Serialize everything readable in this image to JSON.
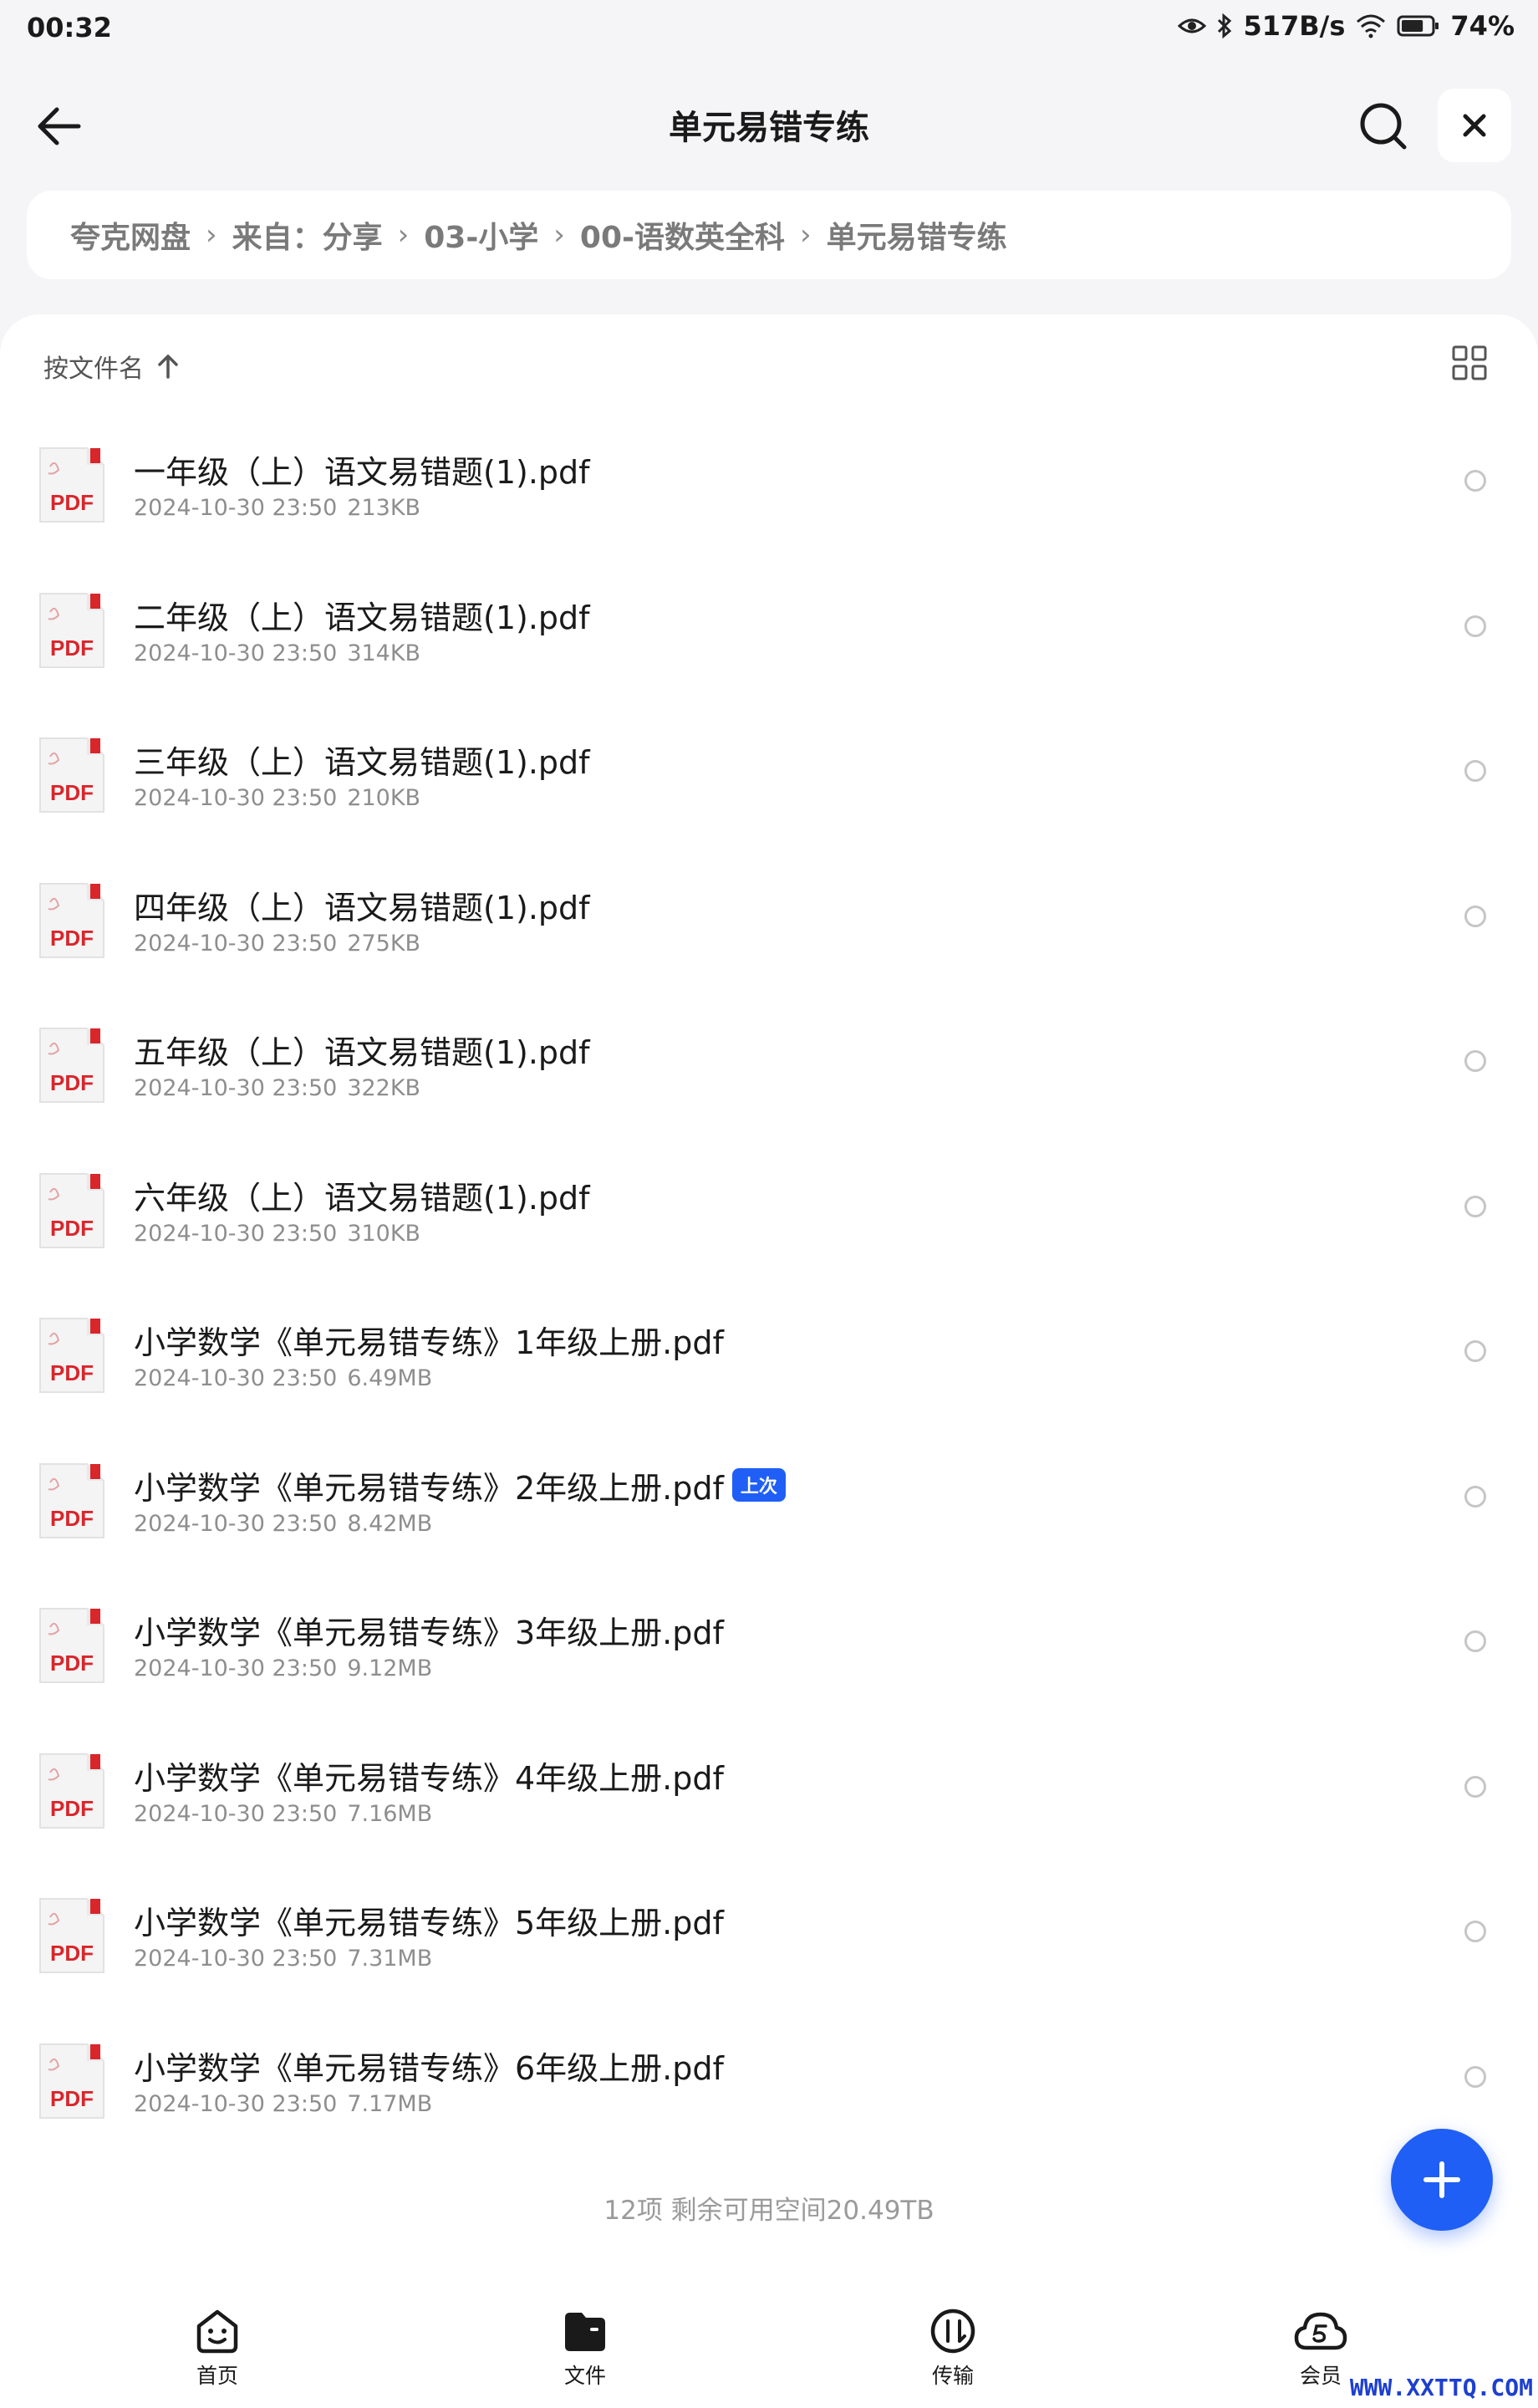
{
  "status_bar": {
    "time": "00:32",
    "net_speed": "517B/s",
    "battery": "74%",
    "battery_level": 0.74,
    "icons": [
      "eye-icon",
      "bluetooth-icon",
      "wifi-icon",
      "battery-icon"
    ]
  },
  "header": {
    "title": "单元易错专练",
    "icons": {
      "back": "back-arrow-icon",
      "search": "search-icon",
      "close": "close-icon"
    }
  },
  "breadcrumb": [
    "夸克网盘",
    "来自：分享",
    "03-小学",
    "00-语数英全科",
    "单元易错专练"
  ],
  "sort": {
    "label": "按文件名",
    "direction": "ascending"
  },
  "files": [
    {
      "name": "一年级（上）语文易错题(1).pdf",
      "date": "2024-10-30 23:50",
      "size": "213KB"
    },
    {
      "name": "二年级（上）语文易错题(1).pdf",
      "date": "2024-10-30 23:50",
      "size": "314KB"
    },
    {
      "name": "三年级（上）语文易错题(1).pdf",
      "date": "2024-10-30 23:50",
      "size": "210KB"
    },
    {
      "name": "四年级（上）语文易错题(1).pdf",
      "date": "2024-10-30 23:50",
      "size": "275KB"
    },
    {
      "name": "五年级（上）语文易错题(1).pdf",
      "date": "2024-10-30 23:50",
      "size": "322KB"
    },
    {
      "name": "六年级（上）语文易错题(1).pdf",
      "date": "2024-10-30 23:50",
      "size": "310KB"
    },
    {
      "name": "小学数学《单元易错专练》1年级上册.pdf",
      "date": "2024-10-30 23:50",
      "size": "6.49MB"
    },
    {
      "name": "小学数学《单元易错专练》2年级上册.pdf",
      "date": "2024-10-30 23:50",
      "size": "8.42MB",
      "badge": "上次"
    },
    {
      "name": "小学数学《单元易错专练》3年级上册.pdf",
      "date": "2024-10-30 23:50",
      "size": "9.12MB"
    },
    {
      "name": "小学数学《单元易错专练》4年级上册.pdf",
      "date": "2024-10-30 23:50",
      "size": "7.16MB"
    },
    {
      "name": "小学数学《单元易错专练》5年级上册.pdf",
      "date": "2024-10-30 23:50",
      "size": "7.31MB"
    },
    {
      "name": "小学数学《单元易错专练》6年级上册.pdf",
      "date": "2024-10-30 23:50",
      "size": "7.17MB"
    }
  ],
  "file_icon_label": "PDF",
  "footer": {
    "info": "12项 剩余可用空间20.49TB"
  },
  "fab": {
    "icon": "plus-icon"
  },
  "bottom_nav": [
    {
      "label": "首页",
      "icon": "home-face-icon"
    },
    {
      "label": "文件",
      "icon": "folder-icon",
      "active": true
    },
    {
      "label": "传输",
      "icon": "transfer-icon"
    },
    {
      "label": "会员",
      "icon": "member-cloud-icon"
    }
  ],
  "watermark": "WWW.XXTTQ.COM",
  "colors": {
    "accent": "#1f5ff5",
    "pdf_red": "#d8262b",
    "background": "#f5f5f7"
  }
}
